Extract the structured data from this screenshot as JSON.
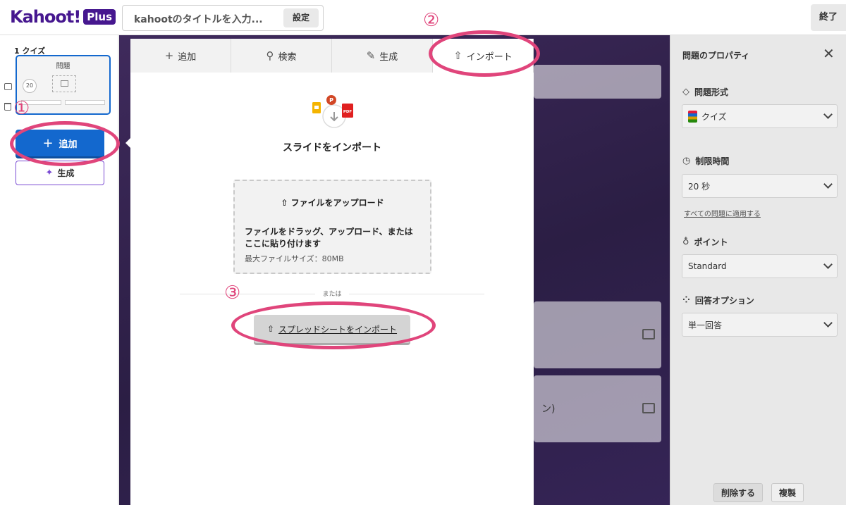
{
  "header": {
    "logo_text": "Kahoot!",
    "logo_badge": "Plus",
    "title_placeholder": "kahootのタイトルを入力...",
    "settings_label": "設定",
    "exit_label": "終了"
  },
  "sidebar": {
    "slide_label": "1 クイズ",
    "thumb_title": "問題",
    "thumb_timer": "20",
    "add_label": "追加",
    "generate_label": "生成"
  },
  "modal": {
    "tabs": [
      {
        "label": "追加",
        "icon": "plus-icon"
      },
      {
        "label": "検索",
        "icon": "search-icon"
      },
      {
        "label": "生成",
        "icon": "wand-icon"
      },
      {
        "label": "インポート",
        "icon": "upload-icon",
        "active": true
      }
    ],
    "import_title": "スライドをインポート",
    "upload_button": "ファイルをアップロード",
    "upload_desc": "ファイルをドラッグ、アップロード、または ここに貼り付けます",
    "upload_max_size": "最大ファイルサイズ：80MB",
    "or_text": "または",
    "spreadsheet_button": "スプレッドシートをインポート",
    "icon_badge_p": "P",
    "icon_badge_pdf": "PDF"
  },
  "background": {
    "partial_text": "ン)"
  },
  "properties": {
    "title": "問題のプロパティ",
    "question_type_label": "問題形式",
    "question_type_value": "クイズ",
    "time_limit_label": "制限時間",
    "time_limit_value": "20 秒",
    "apply_all_link": "すべての問題に適用する",
    "points_label": "ポイント",
    "points_value": "Standard",
    "answer_options_label": "回答オプション",
    "answer_options_value": "単一回答",
    "delete_label": "削除する",
    "duplicate_label": "複製"
  },
  "annotations": {
    "step1": "①",
    "step2": "②",
    "step3": "③",
    "color": "#e0457b"
  }
}
